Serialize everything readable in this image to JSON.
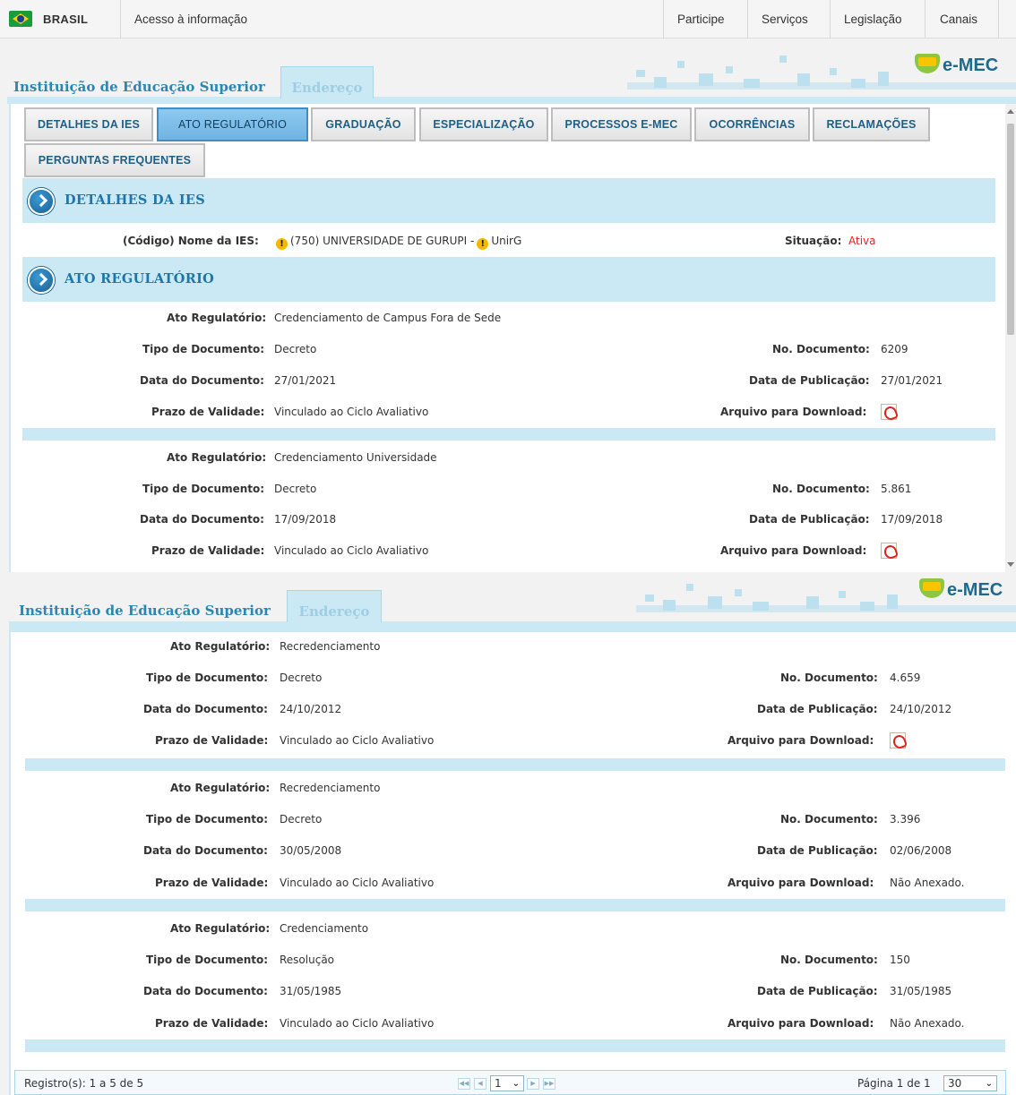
{
  "govbar": {
    "brand": "BRASIL",
    "acesso": "Acesso à informação",
    "menu": [
      "Participe",
      "Serviços",
      "Legislação",
      "Canais"
    ]
  },
  "logo": {
    "text": "e-MEC"
  },
  "tabs": {
    "ies": "Instituição de Educação Superior",
    "endereco": "Endereço"
  },
  "nav": {
    "buttons": [
      "DETALHES DA IES",
      "ATO REGULATÓRIO",
      "GRADUAÇÃO",
      "ESPECIALIZAÇÃO",
      "PROCESSOS E-MEC",
      "OCORRÊNCIAS",
      "RECLAMAÇÕES",
      "PERGUNTAS FREQUENTES"
    ],
    "active": "ATO REGULATÓRIO"
  },
  "sections": {
    "detalhes": "DETALHES DA IES",
    "ato": "ATO REGULATÓRIO"
  },
  "ies": {
    "nome_label": "(Código) Nome da IES:",
    "nome_value": "(750) UNIVERSIDADE DE GURUPI -",
    "sigla": "UnirG",
    "situacao_label": "Situação:",
    "situacao_value": "Ativa"
  },
  "labels": {
    "ato": "Ato Regulatório:",
    "tipo": "Tipo de Documento:",
    "data_doc": "Data do Documento:",
    "prazo": "Prazo de Validade:",
    "no_doc": "No. Documento:",
    "data_pub": "Data de Publicação:",
    "arquivo": "Arquivo para Download:"
  },
  "atos": [
    {
      "ato": "Credenciamento de Campus Fora de Sede",
      "tipo": "Decreto",
      "data_doc": "27/01/2021",
      "prazo": "Vinculado ao Ciclo Avaliativo",
      "no_doc": "6209",
      "data_pub": "27/01/2021",
      "arquivo": "",
      "pdf": true
    },
    {
      "ato": "Credenciamento Universidade",
      "tipo": "Decreto",
      "data_doc": "17/09/2018",
      "prazo": "Vinculado ao Ciclo Avaliativo",
      "no_doc": "5.861",
      "data_pub": "17/09/2018",
      "arquivo": "",
      "pdf": true
    },
    {
      "ato": "Recredenciamento",
      "tipo": "Decreto",
      "data_doc": "24/10/2012",
      "prazo": "Vinculado ao Ciclo Avaliativo",
      "no_doc": "4.659",
      "data_pub": "24/10/2012",
      "arquivo": "",
      "pdf": true
    },
    {
      "ato": "Recredenciamento",
      "tipo": "Decreto",
      "data_doc": "30/05/2008",
      "prazo": "Vinculado ao Ciclo Avaliativo",
      "no_doc": "3.396",
      "data_pub": "02/06/2008",
      "arquivo": "Não Anexado.",
      "pdf": false
    },
    {
      "ato": "Credenciamento",
      "tipo": "Resolução",
      "data_doc": "31/05/1985",
      "prazo": "Vinculado ao Ciclo Avaliativo",
      "no_doc": "150",
      "data_pub": "31/05/1985",
      "arquivo": "Não Anexado.",
      "pdf": false
    }
  ],
  "pager": {
    "registros": "Registro(s): 1 a 5 de 5",
    "page_select": "1",
    "pagina": "Página 1 de 1",
    "page_size": "30"
  },
  "icons": {
    "flag": "brazil-flag-icon",
    "info": "warning-icon",
    "pdf": "pdf-icon",
    "section": "chevron-circle-icon"
  },
  "colors": {
    "accent": "#2a87b3",
    "band": "#cbe9f5",
    "active_tab": "#6fb3e3",
    "status": "#e41e1e"
  }
}
